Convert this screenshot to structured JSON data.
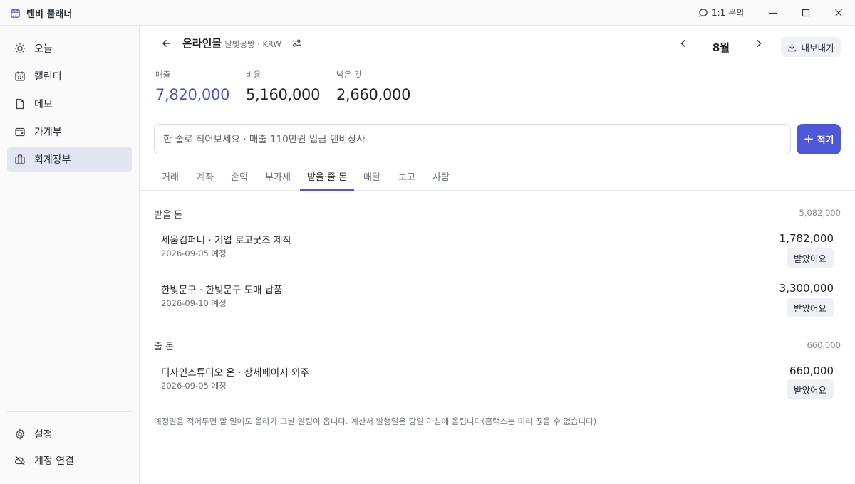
{
  "app": {
    "title": "텐비 플래너",
    "inquiry": "1:1 문의"
  },
  "sidebar": {
    "items": [
      {
        "label": "오늘"
      },
      {
        "label": "캘린더"
      },
      {
        "label": "메모"
      },
      {
        "label": "가계부"
      },
      {
        "label": "회계장부"
      }
    ],
    "bottom": [
      {
        "label": "설정"
      },
      {
        "label": "계정 연결"
      }
    ]
  },
  "header": {
    "title": "온라인몰",
    "subtitle": "달빛공방 · KRW",
    "month": "8월",
    "export_label": "내보내기"
  },
  "stats": [
    {
      "label": "매출",
      "value": "7,820,000"
    },
    {
      "label": "비용",
      "value": "5,160,000"
    },
    {
      "label": "남은 것",
      "value": "2,660,000"
    }
  ],
  "quick_entry": {
    "placeholder": "한 줄로 적어보세요 · 매출 110만원 입금 텐비상사",
    "button": "적기"
  },
  "tabs": [
    "거래",
    "계좌",
    "손익",
    "부가세",
    "받을·줄 돈",
    "매달",
    "보고",
    "사람"
  ],
  "receivable": {
    "title": "받을 돈",
    "total": "5,082,000",
    "items": [
      {
        "title": "세움컴퍼니 · 기업 로고굿즈 제작",
        "date": "2026-09-05 예정",
        "amount": "1,782,000",
        "action": "받았어요"
      },
      {
        "title": "한빛문구 · 한빛문구 도매 납품",
        "date": "2026-09-10 예정",
        "amount": "3,300,000",
        "action": "받았어요"
      }
    ]
  },
  "payable": {
    "title": "줄 돈",
    "total": "660,000",
    "items": [
      {
        "title": "디자인스튜디오 온 · 상세페이지 외주",
        "date": "2026-09-05 예정",
        "amount": "660,000",
        "action": "받았어요"
      }
    ]
  },
  "footnote": "예정일을 적어두면 할 일에도 올라가 그날 알림이 옵니다. 계산서 발행일은 당일 아침에 올립니다(홈택스는 미리 끊을 수 없습니다)",
  "colors": {
    "accent": "#4e57d6",
    "accent_text": "#4b54d1"
  }
}
